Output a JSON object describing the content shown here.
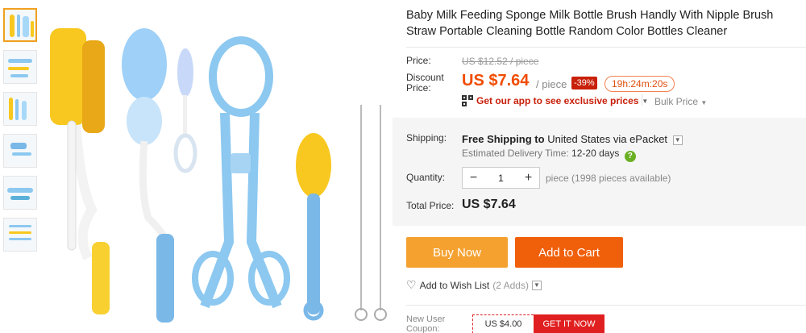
{
  "product": {
    "title": "Baby Milk Feeding Sponge Milk Bottle Brush Handly With Nipple Brush Straw Portable Cleaning Bottle Random Color Bottles Cleaner"
  },
  "thumbnails": {
    "count": 6,
    "selected_index": 0
  },
  "price": {
    "label": "Price:",
    "original": "US $12.52 / piece",
    "discount_label": "Discount Price:",
    "current": "US $7.64",
    "unit": "/ piece",
    "discount_badge": "-39%",
    "timer": "19h:24m:20s",
    "app_promo": "Get our app to see exclusive prices",
    "bulk_price": "Bulk Price"
  },
  "shipping": {
    "label": "Shipping:",
    "free_text": "Free Shipping to",
    "destination": "United States via ePacket",
    "estimated_label": "Estimated Delivery Time:",
    "estimated_value": "12-20 days"
  },
  "quantity": {
    "label": "Quantity:",
    "value": "1",
    "minus": "−",
    "plus": "+",
    "availability": "piece (1998 pieces available)"
  },
  "total": {
    "label": "Total Price:",
    "value": "US $7.64"
  },
  "actions": {
    "buy_now": "Buy Now",
    "add_to_cart": "Add to Cart",
    "wishlist": "Add to Wish List",
    "wishlist_count": "(2 Adds)"
  },
  "coupon": {
    "label": "New User Coupon:",
    "amount": "US $4.00",
    "cta": "GET IT NOW"
  },
  "colors": {
    "accent_orange": "#f05f0a",
    "buy_orange": "#f5a130",
    "price_red": "#f04c00",
    "badge_red": "#c8200a",
    "product_blue": "#8cc8f0",
    "product_yellow": "#f8c820"
  }
}
